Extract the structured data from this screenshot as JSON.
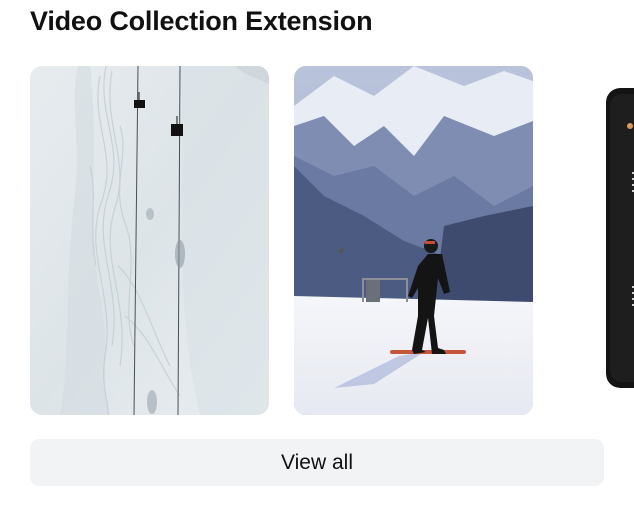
{
  "section": {
    "title": "Video Collection Extension"
  },
  "cards": [
    {
      "name": "video-card-ski-lift",
      "subject": "aerial snowy slope with chairlift"
    },
    {
      "name": "video-card-snowboarder",
      "subject": "snowboarder standing on mountain slope"
    },
    {
      "name": "video-card-snowboard",
      "subject": "black snowboard (partially visible)"
    }
  ],
  "actions": {
    "view_all_label": "View all"
  },
  "colors": {
    "button_bg": "#f2f3f5",
    "title_text": "#111111"
  }
}
